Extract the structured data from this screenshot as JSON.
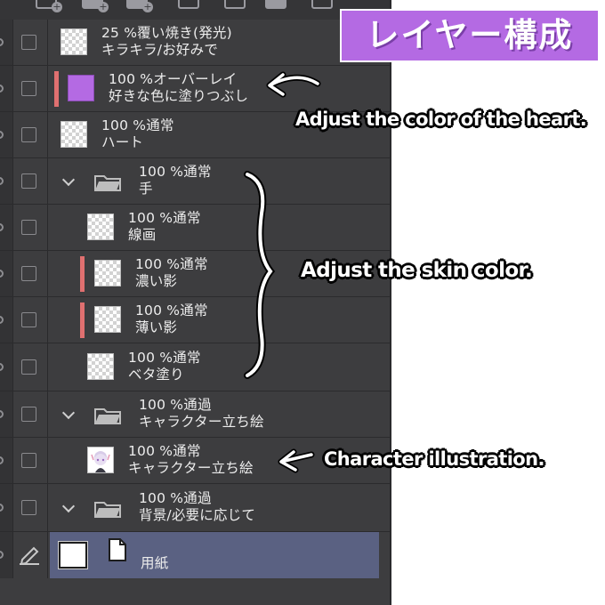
{
  "title_badge": "レイヤー構成",
  "layers": [
    {
      "opacity_mode": "25 %覆い焼き(発光)",
      "name": "キラキラ/お好みで"
    },
    {
      "opacity_mode": "100 %オーバーレイ",
      "name": "好きな色に塗りつぶし"
    },
    {
      "opacity_mode": "100 %通常",
      "name": "ハート"
    },
    {
      "opacity_mode": "100 %通常",
      "name": "手"
    },
    {
      "opacity_mode": "100 %通常",
      "name": "線画"
    },
    {
      "opacity_mode": "100 %通常",
      "name": "濃い影"
    },
    {
      "opacity_mode": "100 %通常",
      "name": "薄い影"
    },
    {
      "opacity_mode": "100 %通常",
      "name": "ベタ塗り"
    },
    {
      "opacity_mode": "100 %通過",
      "name": "キャラクター立ち絵"
    },
    {
      "opacity_mode": "100 %通常",
      "name": "キャラクター立ち絵"
    },
    {
      "opacity_mode": "100 %通過",
      "name": "背景/必要に応じて"
    },
    {
      "opacity_mode": "",
      "name": "用紙"
    }
  ],
  "annotations": {
    "heart": "Adjust the color of the heart.",
    "skin": "Adjust the skin color.",
    "character": "Character illustration."
  },
  "colors": {
    "panel_bg": "#3d3d3f",
    "selected_row": "#5a6182",
    "clipping_indicator": "#e07070",
    "overlay_fill": "#b46ae3",
    "badge_bg": "#b46ae3"
  },
  "icons": [
    "folder-icon",
    "chevron-down-icon",
    "pen-icon",
    "page-icon",
    "eye-icon"
  ]
}
